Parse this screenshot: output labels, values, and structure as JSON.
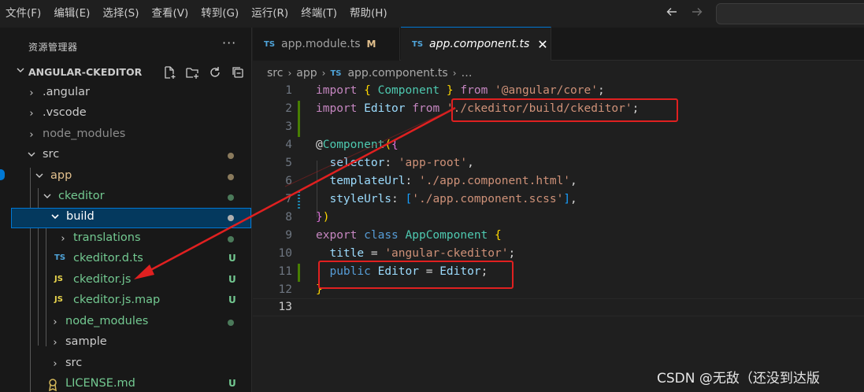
{
  "menu": [
    "文件(F)",
    "编辑(E)",
    "选择(S)",
    "查看(V)",
    "转到(G)",
    "运行(R)",
    "终端(T)",
    "帮助(H)"
  ],
  "nav": {
    "back_icon": "arrow-left-icon",
    "forward_icon": "arrow-right-icon"
  },
  "sidebar": {
    "title": "资源管理器",
    "more": "···",
    "project": "ANGULAR-CKEDITOR",
    "tree": [
      {
        "label": ".angular",
        "chevron": "›",
        "color": "#cccccc"
      },
      {
        "label": ".vscode",
        "chevron": "›",
        "color": "#cccccc"
      },
      {
        "label": "node_modules",
        "chevron": "›",
        "color": "#8c8c8c"
      },
      {
        "label": "src",
        "chevron": "⌄",
        "color": "#cccccc"
      },
      {
        "label": "app",
        "chevron": "⌄",
        "color": "#e2c08d"
      },
      {
        "label": "ckeditor",
        "chevron": "⌄",
        "color": "#73c991"
      },
      {
        "label": "build",
        "chevron": "⌄",
        "color": "#ffffff"
      },
      {
        "label": "translations",
        "chevron": "›",
        "color": "#73c991"
      },
      {
        "label": "ckeditor.d.ts",
        "badge": "TS",
        "status": "U",
        "color": "#73c991"
      },
      {
        "label": "ckeditor.js",
        "badge": "JS",
        "status": "U",
        "color": "#73c991"
      },
      {
        "label": "ckeditor.js.map",
        "badge": "JS",
        "status": "U",
        "color": "#73c991"
      },
      {
        "label": "node_modules",
        "chevron": "›",
        "color": "#73c991"
      },
      {
        "label": "sample",
        "chevron": "›",
        "color": "#cccccc"
      },
      {
        "label": "src",
        "chevron": "›",
        "color": "#cccccc"
      },
      {
        "label": "LICENSE.md",
        "badge": "LIC",
        "status": "U",
        "color": "#73c991"
      }
    ]
  },
  "tabs": [
    {
      "badge": "TS",
      "label": "app.module.ts",
      "modified": "M"
    },
    {
      "badge": "TS",
      "label": "app.component.ts",
      "close": "✕"
    }
  ],
  "breadcrumb": [
    "src",
    "app",
    "app.component.ts",
    "…"
  ],
  "breadcrumb_badge": "TS",
  "code": {
    "line_numbers": [
      "1",
      "2",
      "3",
      "4",
      "5",
      "6",
      "7",
      "8",
      "9",
      "10",
      "11",
      "12",
      "13"
    ],
    "l1": [
      "import",
      "{",
      "Component",
      "}",
      "from",
      "'@angular/core'",
      ";"
    ],
    "l2": [
      "import",
      "Editor",
      "from",
      "'./ckeditor/build/ckeditor'",
      ";"
    ],
    "l4": [
      "@",
      "Component",
      "(",
      "{"
    ],
    "l5": [
      "selector",
      ":",
      "'app-root'",
      ","
    ],
    "l6": [
      "templateUrl",
      ":",
      "'./app.component.html'",
      ","
    ],
    "l7": [
      "styleUrls",
      ":",
      "[",
      "'./app.component.scss'",
      "]",
      ","
    ],
    "l8": [
      "}",
      ")"
    ],
    "l9": [
      "export",
      "class",
      "AppComponent",
      "{"
    ],
    "l10": [
      "title",
      "=",
      "'angular-ckeditor'",
      ";"
    ],
    "l11": [
      "public",
      "Editor",
      "=",
      "Editor",
      ";"
    ],
    "l12": [
      "}"
    ]
  },
  "watermark": "CSDN @无敌（还没到达版"
}
